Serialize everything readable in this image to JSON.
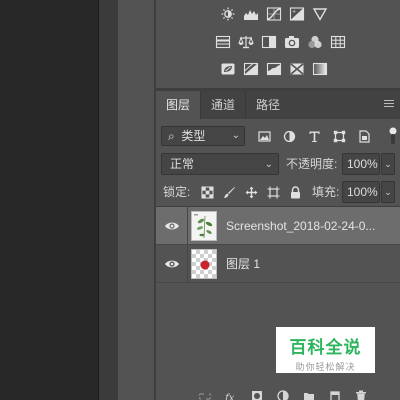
{
  "adjustments": {
    "row1": [
      "brightness-contrast-icon",
      "levels-icon",
      "curves-icon",
      "exposure-icon",
      "vibrance-icon"
    ],
    "row2": [
      "hue-saturation-icon",
      "color-balance-icon",
      "black-white-icon",
      "photo-filter-icon",
      "channel-mixer-icon",
      "color-lookup-icon"
    ],
    "row3": [
      "invert-icon",
      "posterize-icon",
      "threshold-icon",
      "selective-color-icon",
      "gradient-map-icon"
    ]
  },
  "layers_panel": {
    "tabs": [
      {
        "label": "图层"
      },
      {
        "label": "通道"
      },
      {
        "label": "路径"
      }
    ],
    "filter": {
      "kind_label": "类型"
    },
    "blend_mode": "正常",
    "opacity_label": "不透明度:",
    "opacity_value": "100%",
    "lock_label": "锁定:",
    "fill_label": "填充:",
    "fill_value": "100%",
    "layers": [
      {
        "name": "Screenshot_2018-02-24-0...",
        "selected": true
      },
      {
        "name": "图层 1",
        "selected": false
      }
    ]
  },
  "watermark": {
    "title": "百科全说",
    "subtitle": "助你轻松解决"
  },
  "colors": {
    "panel_bg": "#535353",
    "selected_row": "#6d6d6d",
    "canvas_bg": "#282828",
    "watermark_green": "#2db55d",
    "layer_dot_red": "#c8262b"
  }
}
